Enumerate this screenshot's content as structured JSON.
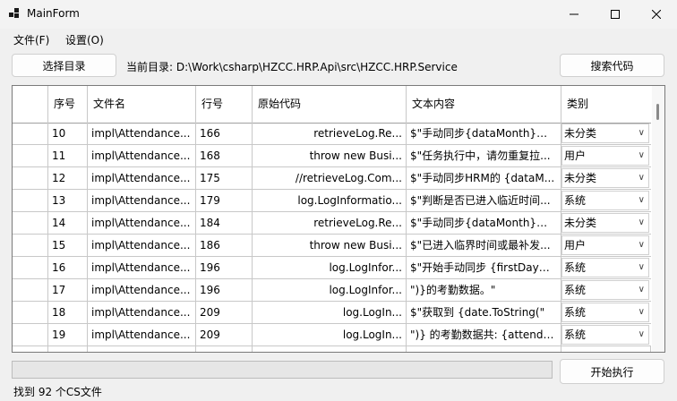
{
  "window": {
    "title": "MainForm"
  },
  "menu": [
    {
      "label": "文件(F)"
    },
    {
      "label": "设置(O)"
    }
  ],
  "toolbar": {
    "select_dir_label": "选择目录",
    "current_dir_label": "当前目录: D:\\Work\\csharp\\HZCC.HRP.Api\\src\\HZCC.HRP.Service",
    "search_code_label": "搜索代码"
  },
  "table": {
    "columns": [
      "序号",
      "文件名",
      "行号",
      "原始代码",
      "文本内容",
      "类别"
    ],
    "rows": [
      {
        "seq": "10",
        "file": "impl\\Attendance...",
        "line": "166",
        "code": "retrieveLog.Re...",
        "text": "$\"手动同步{dataMonth}考...",
        "category": "未分类"
      },
      {
        "seq": "11",
        "file": "impl\\Attendance...",
        "line": "168",
        "code": "throw new Busi...",
        "text": "$\"任务执行中，请勿重复拉...",
        "category": "用户"
      },
      {
        "seq": "12",
        "file": "impl\\Attendance...",
        "line": "175",
        "code": "//retrieveLog.Com...",
        "text": "$\"手动同步HRM的 {dataM...",
        "category": "未分类"
      },
      {
        "seq": "13",
        "file": "impl\\Attendance...",
        "line": "179",
        "code": "log.LogInformatio...",
        "text": "$\"判断是否已进入临近时间...",
        "category": "系统"
      },
      {
        "seq": "14",
        "file": "impl\\Attendance...",
        "line": "184",
        "code": "retrieveLog.Re...",
        "text": "$\"手动同步{dataMonth}考...",
        "category": "未分类"
      },
      {
        "seq": "15",
        "file": "impl\\Attendance...",
        "line": "186",
        "code": "throw new Busi...",
        "text": "$\"已进入临界时间或最补发...",
        "category": "用户"
      },
      {
        "seq": "16",
        "file": "impl\\Attendance...",
        "line": "196",
        "code": "log.LogInfor...",
        "text": "$\"开始手动同步 {firstDayOf...",
        "category": "系统"
      },
      {
        "seq": "17",
        "file": "impl\\Attendance...",
        "line": "196",
        "code": "log.LogInfor...",
        "text": "\")}的考勤数据。\"",
        "category": "系统"
      },
      {
        "seq": "18",
        "file": "impl\\Attendance...",
        "line": "209",
        "code": "log.LogIn...",
        "text": "$\"获取到 {date.ToString(\"",
        "category": "系统"
      },
      {
        "seq": "19",
        "file": "impl\\Attendance...",
        "line": "209",
        "code": "log.LogIn...",
        "text": "\")} 的考勤数据共: {attendan...",
        "category": "系统"
      }
    ]
  },
  "actions": {
    "start_label": "开始执行"
  },
  "status": {
    "text": "找到 92 个CS文件"
  },
  "icons": {
    "dropdown": "chevron-down-icon"
  }
}
